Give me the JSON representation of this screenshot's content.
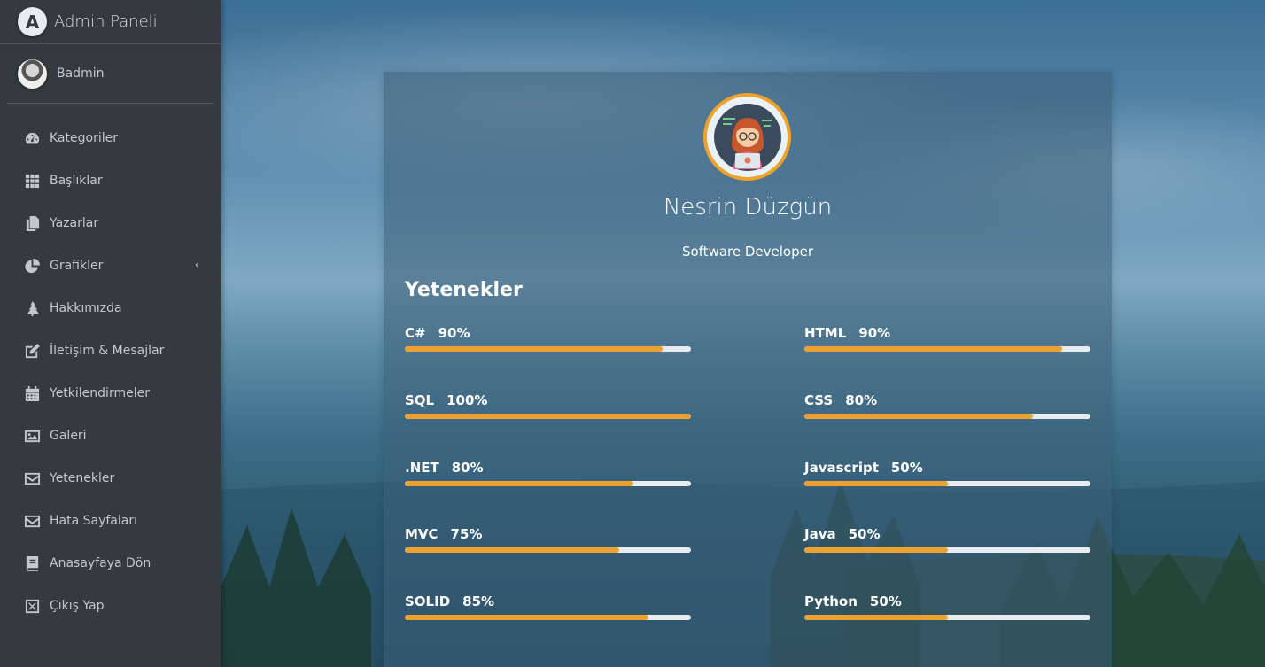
{
  "brand": {
    "name": "Admin Paneli",
    "logo_letter": "A"
  },
  "user": {
    "name": "Badmin"
  },
  "sidebar": {
    "items": [
      {
        "label": "Kategoriler",
        "icon": "dashboard-gauge-icon"
      },
      {
        "label": "Başlıklar",
        "icon": "grid-icon"
      },
      {
        "label": "Yazarlar",
        "icon": "copy-files-icon"
      },
      {
        "label": "Grafikler",
        "icon": "pie-chart-icon",
        "has_submenu": true
      },
      {
        "label": "Hakkımızda",
        "icon": "tree-icon"
      },
      {
        "label": "İletişim & Mesajlar",
        "icon": "edit-icon"
      },
      {
        "label": "Yetkilendirmeler",
        "icon": "calendar-icon"
      },
      {
        "label": "Galeri",
        "icon": "image-icon"
      },
      {
        "label": "Yetenekler",
        "icon": "envelope-icon"
      },
      {
        "label": "Hata Sayfaları",
        "icon": "envelope-icon"
      },
      {
        "label": "Anasayfaya Dön",
        "icon": "book-icon"
      },
      {
        "label": "Çıkış Yap",
        "icon": "close-box-icon"
      }
    ],
    "submenu_arrow": "‹"
  },
  "profile": {
    "name": "Nesrin Düzgün",
    "title": "Software Developer"
  },
  "skills": {
    "heading": "Yetenekler",
    "left": [
      {
        "name": "C#",
        "percent_label": "90%",
        "percent": 90
      },
      {
        "name": "SQL",
        "percent_label": "100%",
        "percent": 100
      },
      {
        "name": ".NET",
        "percent_label": "80%",
        "percent": 80
      },
      {
        "name": "MVC",
        "percent_label": "75%",
        "percent": 75
      },
      {
        "name": "SOLID",
        "percent_label": "85%",
        "percent": 85
      }
    ],
    "right": [
      {
        "name": "HTML",
        "percent_label": "90%",
        "percent": 90
      },
      {
        "name": "CSS",
        "percent_label": "80%",
        "percent": 80
      },
      {
        "name": "Javascript",
        "percent_label": "50%",
        "percent": 50
      },
      {
        "name": "Java",
        "percent_label": "50%",
        "percent": 50
      },
      {
        "name": "Python",
        "percent_label": "50%",
        "percent": 50
      }
    ]
  },
  "colors": {
    "sidebar_bg": "#343a40",
    "accent": "#eda131",
    "track": "#e9ecef"
  }
}
